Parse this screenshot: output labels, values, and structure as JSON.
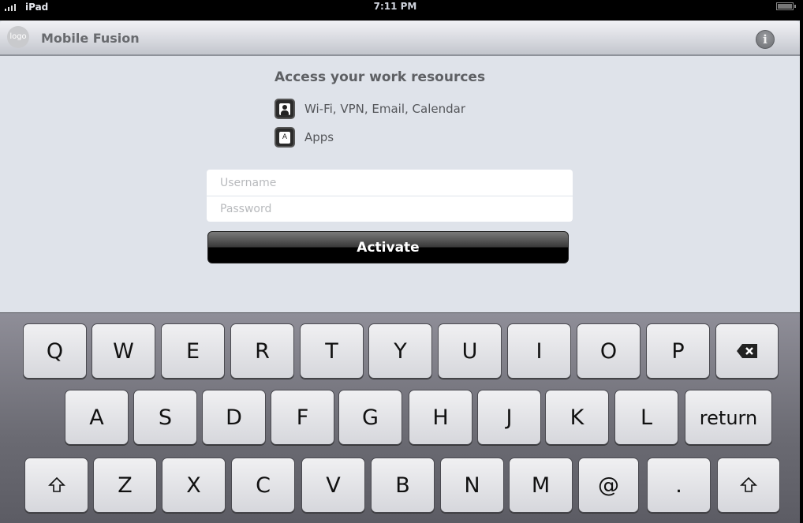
{
  "status_bar": {
    "carrier": "iPad",
    "time": "7:11 PM",
    "signal_icon": "signal-bars-icon",
    "battery_icon": "battery-icon"
  },
  "nav": {
    "logo_text": "logo",
    "title": "Mobile Fusion",
    "info_icon": "i"
  },
  "main": {
    "heading": "Access your work resources",
    "resources": [
      {
        "icon": "person-icon",
        "label": "Wi-Fi, VPN, Email, Calendar"
      },
      {
        "icon": "apps-icon",
        "icon_text": "A",
        "label": "Apps"
      }
    ],
    "username_placeholder": "Username",
    "password_placeholder": "Password",
    "activate_label": "Activate"
  },
  "keyboard": {
    "row1": [
      "Q",
      "W",
      "E",
      "R",
      "T",
      "Y",
      "U",
      "I",
      "O",
      "P"
    ],
    "row2": [
      "A",
      "S",
      "D",
      "F",
      "G",
      "H",
      "J",
      "K",
      "L"
    ],
    "row3": [
      "Z",
      "X",
      "C",
      "V",
      "B",
      "N",
      "M",
      "@",
      "."
    ],
    "backspace": "⌫",
    "return_label": "return",
    "shift": "⇧"
  }
}
